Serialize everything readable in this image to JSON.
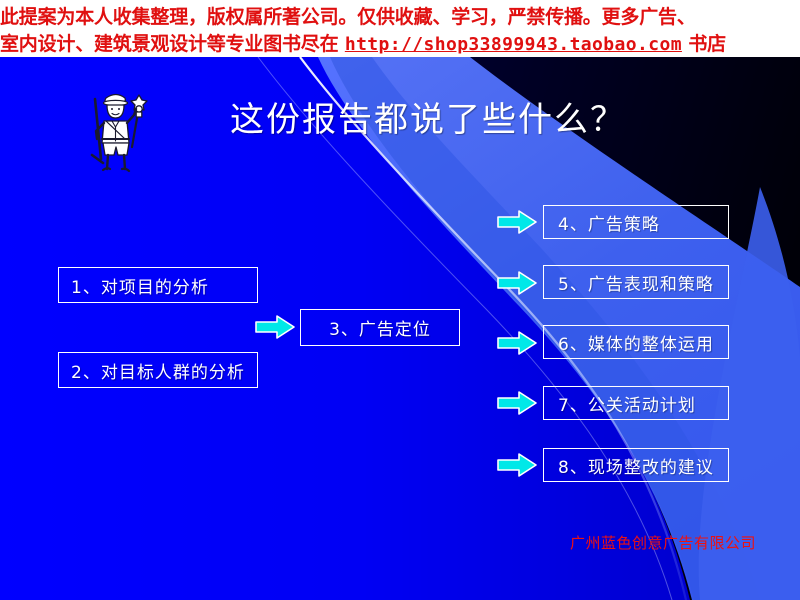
{
  "header": {
    "line1": "此提案为本人收集整理，版权属所著公司。仅供收藏、学习，严禁传播。更多广告、",
    "line2_prefix": "室内设计、建筑景观设计等专业图书尽在 ",
    "line2_url": "http://shop33899943.taobao.com",
    "line2_suffix": " 书店"
  },
  "slide": {
    "title": "这份报告都说了些什么？",
    "clipart_name": "person-with-torch-clipart",
    "footer_company": "广州蓝色创意广告有限公司"
  },
  "nodes": {
    "left": [
      {
        "id": "node-1",
        "label": "1、对项目的分析"
      },
      {
        "id": "node-2",
        "label": "2、对目标人群的分析"
      }
    ],
    "center": [
      {
        "id": "node-3",
        "label": "3、广告定位"
      }
    ],
    "right": [
      {
        "id": "node-4",
        "label": "4、广告策略"
      },
      {
        "id": "node-5",
        "label": "5、广告表现和策略"
      },
      {
        "id": "node-6",
        "label": "6、媒体的整体运用"
      },
      {
        "id": "node-7",
        "label": "7、公关活动计划"
      },
      {
        "id": "node-8",
        "label": "8、现场整改的建议"
      }
    ]
  },
  "arrows": {
    "center_arrow_name": "arrow-to-node-3",
    "right_arrow_names": [
      "arrow-to-node-4",
      "arrow-to-node-5",
      "arrow-to-node-6",
      "arrow-to-node-7",
      "arrow-to-node-8"
    ]
  },
  "colors": {
    "background_blue": "#0000FF",
    "background_dark_navy": "#000018",
    "band_blue": "#3C5FEE",
    "arrow_fill": "#00E8E8",
    "arrow_outline": "#FFFFFF",
    "node_border": "#FFFFFF",
    "node_text": "#FFFFFF",
    "header_text": "#E01010",
    "footer_text": "#EE1111"
  }
}
